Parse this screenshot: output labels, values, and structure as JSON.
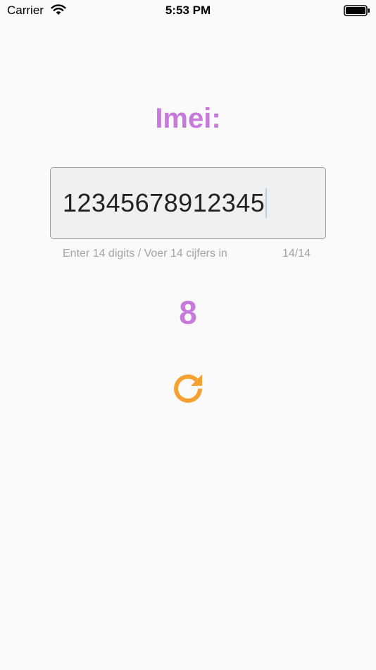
{
  "status_bar": {
    "carrier": "Carrier",
    "time": "5:53 PM"
  },
  "title": "Imei:",
  "imei_input": {
    "value": "12345678912345",
    "helper": "Enter 14 digits / Voer 14 cijfers in",
    "counter": "14/14"
  },
  "result": {
    "check_digit": "8"
  },
  "colors": {
    "accent_purple": "#c879dc",
    "refresh_orange": "#f5a030"
  },
  "icons": {
    "refresh": "refresh-icon"
  }
}
